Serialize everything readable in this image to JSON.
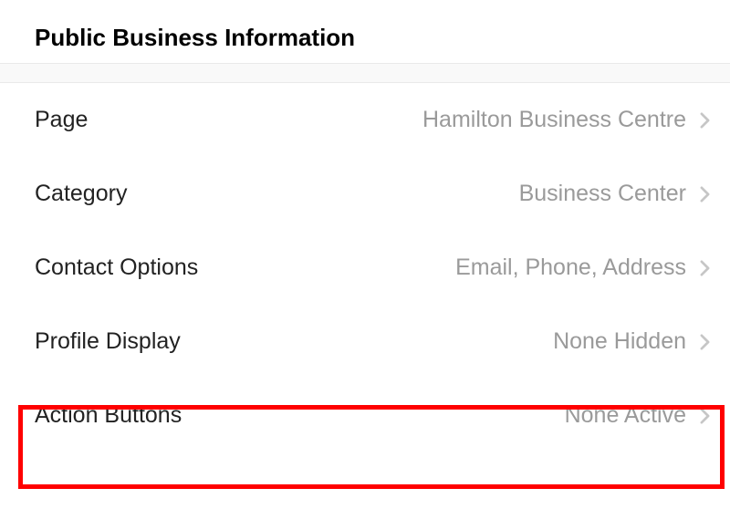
{
  "section_title": "Public Business Information",
  "rows": [
    {
      "label": "Page",
      "value": "Hamilton Business Centre"
    },
    {
      "label": "Category",
      "value": "Business Center"
    },
    {
      "label": "Contact Options",
      "value": "Email, Phone, Address"
    },
    {
      "label": "Profile Display",
      "value": "None Hidden"
    },
    {
      "label": "Action Buttons",
      "value": "None Active"
    }
  ]
}
